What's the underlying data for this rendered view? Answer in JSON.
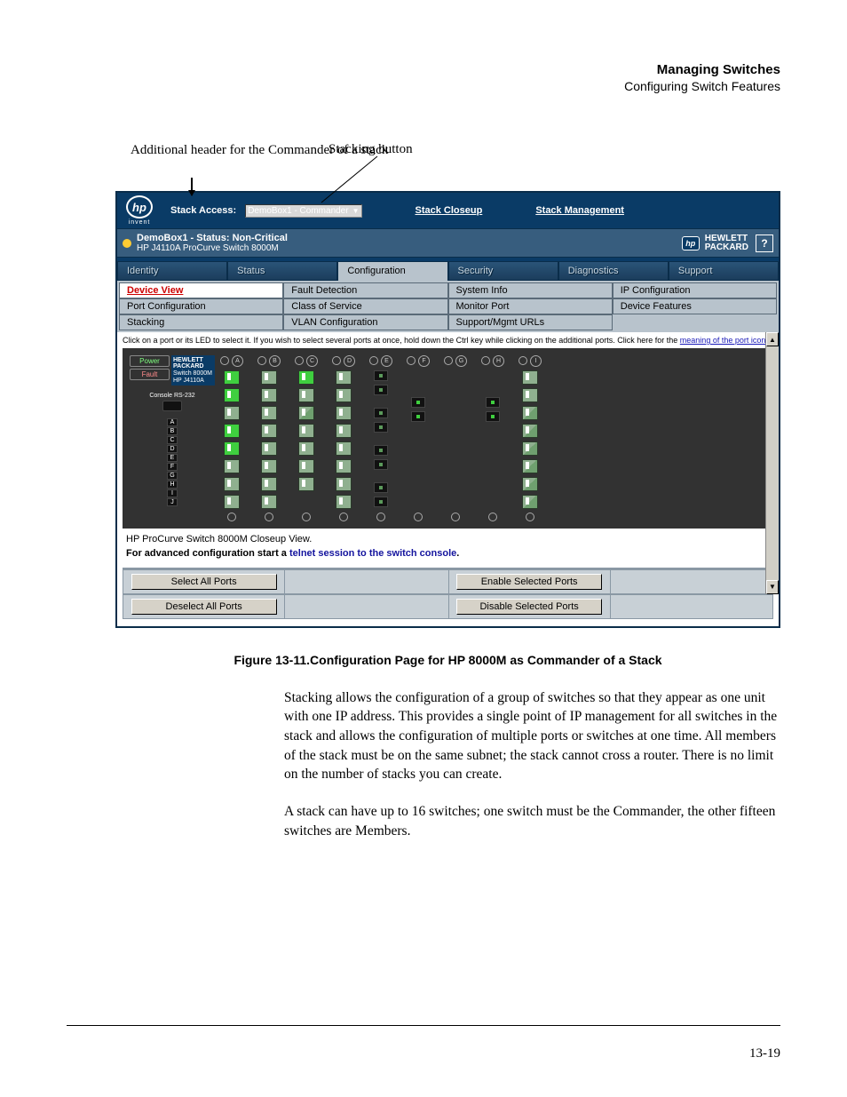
{
  "doc_header": {
    "line1": "Managing Switches",
    "line2": "Configuring Switch Features"
  },
  "callouts": {
    "left": "Additional header for the Commander of a stack",
    "right": "Stacking button"
  },
  "stack_bar": {
    "logo_text": "hp",
    "logo_sub": "invent",
    "access_label": "Stack Access:",
    "select_value": "DemoBox1 - Commander",
    "links": [
      "Stack Closeup",
      "Stack Management"
    ]
  },
  "status": {
    "title": "DemoBox1 - Status: Non-Critical",
    "subtitle": "HP J4110A ProCurve Switch 8000M",
    "brand": "HEWLETT\nPACKARD",
    "help": "?"
  },
  "top_tabs": [
    "Identity",
    "Status",
    "Configuration",
    "Security",
    "Diagnostics",
    "Support"
  ],
  "top_tab_active": 2,
  "sub_tabs": [
    [
      "Device View",
      "Fault Detection",
      "System Info",
      "IP Configuration"
    ],
    [
      "Port Configuration",
      "Class of Service",
      "Monitor Port",
      "Device Features"
    ],
    [
      "Stacking",
      "VLAN Configuration",
      "Support/Mgmt URLs",
      ""
    ]
  ],
  "sub_tab_active": "Device View",
  "panel": {
    "hint_before": "Click on a port or its LED to select it. If you wish to select several ports at once, hold down the Ctrl key while clicking on the additional ports. Click here for the ",
    "hint_link": "meaning of the port icons.",
    "power": "Power",
    "fault": "Fault",
    "chip_brand": "HEWLETT PACKARD",
    "chip_model1": "Switch 8000M",
    "chip_model2": "HP J4110A",
    "console_label": "Console RS-232",
    "slot_letters": [
      "A",
      "B",
      "C",
      "D",
      "E",
      "F",
      "G",
      "H",
      "I",
      "J"
    ],
    "slot_ids": [
      "A",
      "B",
      "C",
      "D",
      "E",
      "F",
      "G",
      "H",
      "I"
    ],
    "caption": "HP ProCurve Switch 8000M Closeup View.",
    "advanced_before": "For advanced configuration start a ",
    "advanced_link": "telnet session to the switch console",
    "advanced_after": "."
  },
  "buttons": {
    "select_all": "Select All Ports",
    "deselect_all": "Deselect All Ports",
    "enable_sel": "Enable Selected Ports",
    "disable_sel": "Disable Selected Ports"
  },
  "figure_caption": "Figure 13-11.Configuration Page for HP 8000M as Commander of a Stack",
  "paragraph1": "Stacking allows the configuration of a group of switches so that they appear as one unit with one IP address. This provides a single point of IP management for all switches in the stack and allows the configuration of multiple ports or switches at one time. All members of the stack must be on the same subnet; the stack cannot cross a router. There is no limit on the number of stacks you can create.",
  "paragraph2": "A stack can have up to 16 switches; one switch must be the Commander, the other fifteen switches are Members.",
  "page_number": "13-19"
}
